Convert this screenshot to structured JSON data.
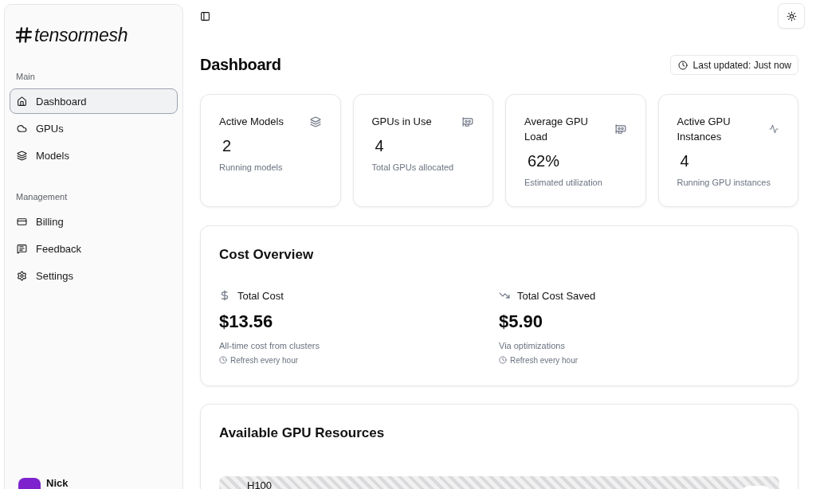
{
  "sidebar": {
    "logo": "tensormesh",
    "sections": [
      {
        "title": "Main",
        "items": [
          {
            "label": "Dashboard",
            "selected": true
          },
          {
            "label": "GPUs",
            "selected": false
          },
          {
            "label": "Models",
            "selected": false
          }
        ]
      },
      {
        "title": "Management",
        "items": [
          {
            "label": "Billing",
            "selected": false
          },
          {
            "label": "Feedback",
            "selected": false
          },
          {
            "label": "Settings",
            "selected": false
          }
        ]
      }
    ],
    "user": {
      "name": "Nick"
    }
  },
  "header": {
    "title": "Dashboard",
    "last_updated": "Last updated: Just now"
  },
  "stats": [
    {
      "title": "Active Models",
      "value": "2",
      "caption": "Running models"
    },
    {
      "title": "GPUs in Use",
      "value": "4",
      "caption": "Total GPUs allocated"
    },
    {
      "title": "Average GPU Load",
      "value": "62%",
      "caption": "Estimated utilization"
    },
    {
      "title": "Active GPU Instances",
      "value": "4",
      "caption": "Running GPU instances"
    }
  ],
  "cost_overview": {
    "title": "Cost Overview",
    "items": [
      {
        "label": "Total Cost",
        "value": "$13.56",
        "caption": "All-time cost from clusters",
        "refresh": "Refresh every hour"
      },
      {
        "label": "Total Cost Saved",
        "value": "$5.90",
        "caption": "Via optimizations",
        "refresh": "Refresh every hour"
      }
    ]
  },
  "gpu_resources": {
    "title": "Available GPU Resources",
    "rows": [
      {
        "name": "H100"
      }
    ]
  }
}
